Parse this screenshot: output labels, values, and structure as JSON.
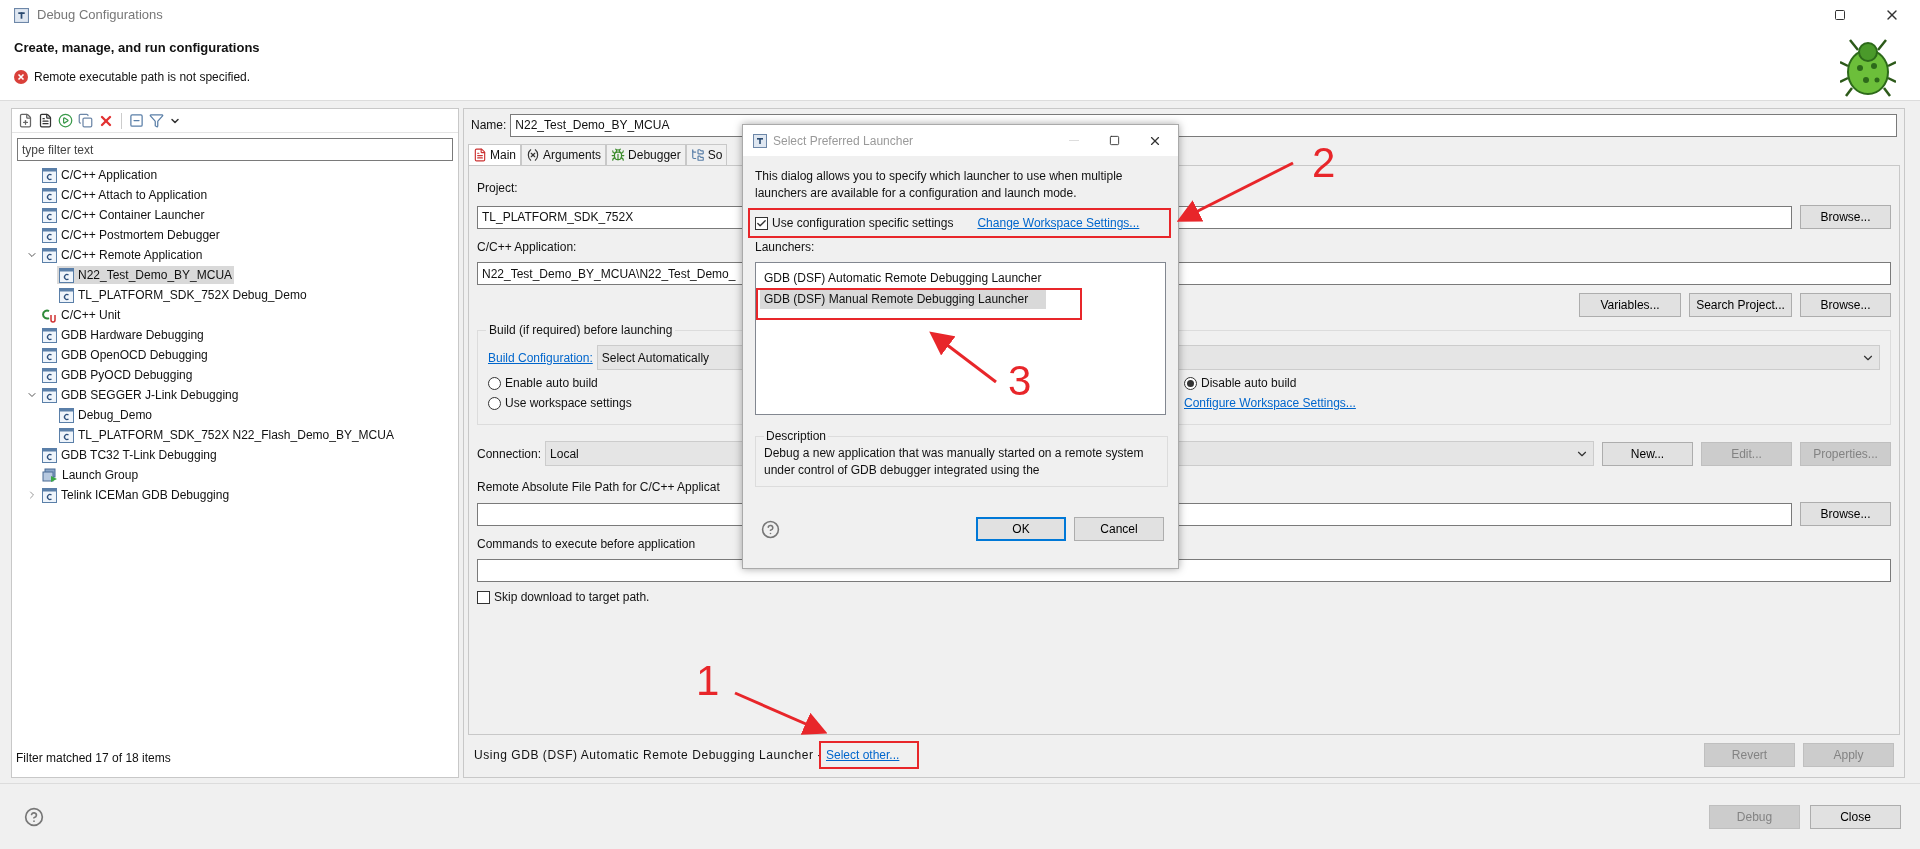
{
  "window": {
    "title": "Debug Configurations"
  },
  "header": {
    "title": "Create, manage, and run configurations",
    "message": "Remote executable path is not specified."
  },
  "sidebar": {
    "filter_placeholder": "type filter text",
    "items": [
      {
        "label": "C/C++ Application",
        "kind": "config",
        "selected": false
      },
      {
        "label": "C/C++ Attach to Application",
        "kind": "config",
        "selected": false
      },
      {
        "label": "C/C++ Container Launcher",
        "kind": "config",
        "selected": false
      },
      {
        "label": "C/C++ Postmortem Debugger",
        "kind": "config",
        "selected": false
      },
      {
        "label": "C/C++ Remote Application",
        "kind": "config",
        "selected": false,
        "expanded": true,
        "children": [
          {
            "label": "N22_Test_Demo_BY_MCUA",
            "kind": "config",
            "selected": true
          },
          {
            "label": "TL_PLATFORM_SDK_752X Debug_Demo",
            "kind": "config",
            "selected": false
          }
        ]
      },
      {
        "label": "C/C++ Unit",
        "kind": "unit",
        "selected": false
      },
      {
        "label": "GDB Hardware Debugging",
        "kind": "config",
        "selected": false
      },
      {
        "label": "GDB OpenOCD Debugging",
        "kind": "config",
        "selected": false
      },
      {
        "label": "GDB PyOCD Debugging",
        "kind": "config",
        "selected": false
      },
      {
        "label": "GDB SEGGER J-Link Debugging",
        "kind": "config",
        "selected": false,
        "expanded": true,
        "children": [
          {
            "label": "Debug_Demo",
            "kind": "config",
            "selected": false
          },
          {
            "label": "TL_PLATFORM_SDK_752X N22_Flash_Demo_BY_MCUA",
            "kind": "config",
            "selected": false
          }
        ]
      },
      {
        "label": "GDB TC32 T-Link Debugging",
        "kind": "config",
        "selected": false
      },
      {
        "label": "Launch Group",
        "kind": "group",
        "selected": false
      },
      {
        "label": "Telink ICEMan GDB Debugging",
        "kind": "config",
        "selected": false,
        "expanded": false
      }
    ],
    "status": "Filter matched 17 of 18 items"
  },
  "name": {
    "label": "Name:",
    "value": "N22_Test_Demo_BY_MCUA"
  },
  "tabs": [
    {
      "label": "Main",
      "kind": "main",
      "selected": true
    },
    {
      "label": "Arguments",
      "kind": "arguments",
      "selected": false
    },
    {
      "label": "Debugger",
      "kind": "debugger",
      "selected": false
    },
    {
      "label": "So",
      "kind": "source",
      "selected": false
    }
  ],
  "main": {
    "project_label": "Project:",
    "project_value": "TL_PLATFORM_SDK_752X",
    "project_button": "Browse...",
    "app_label": "C/C++ Application:",
    "app_value": "N22_Test_Demo_BY_MCUA\\N22_Test_Demo_",
    "app_buttons": [
      "Variables...",
      "Search Project...",
      "Browse..."
    ],
    "build": {
      "legend": "Build (if required) before launching",
      "config_link": "Build Configuration:",
      "config_value": "Select Automatically",
      "options": [
        {
          "label": "Enable auto build",
          "selected": false
        },
        {
          "label": "Disable auto build",
          "selected": true
        },
        {
          "label": "Use workspace settings",
          "selected": false
        }
      ],
      "workspace_link": "Configure Workspace Settings..."
    },
    "connection": {
      "label": "Connection:",
      "value": "Local",
      "buttons": [
        {
          "label": "New...",
          "disabled": false
        },
        {
          "label": "Edit...",
          "disabled": true
        },
        {
          "label": "Properties...",
          "disabled": true
        }
      ]
    },
    "remote_path": {
      "label": "Remote Absolute File Path for C/C++ Applicat",
      "button": "Browse..."
    },
    "commands": {
      "label": "Commands to execute before application"
    },
    "skip_download": {
      "label": "Skip download to target path.",
      "checked": false
    }
  },
  "launcher_line": {
    "text": "Using GDB (DSF) Automatic Remote Debugging Launcher -",
    "link": "Select other..."
  },
  "panel_buttons": [
    {
      "label": "Revert",
      "disabled": true
    },
    {
      "label": "Apply",
      "disabled": true
    }
  ],
  "footer_buttons": [
    {
      "label": "Debug",
      "disabled": true
    },
    {
      "label": "Close",
      "disabled": false
    }
  ],
  "dialog": {
    "title": "Select Preferred Launcher",
    "intro": "This dialog allows you to specify which launcher to use when multiple launchers are available for a configuration and launch mode.",
    "use_specific": {
      "label": "Use configuration specific settings",
      "checked": true
    },
    "workspace_link": "Change Workspace Settings...",
    "launchers_label": "Launchers:",
    "launchers": [
      {
        "label": "GDB (DSF) Automatic Remote Debugging Launcher",
        "selected": false
      },
      {
        "label": "GDB (DSF) Manual Remote Debugging Launcher",
        "selected": true
      }
    ],
    "description_legend": "Description",
    "description": "Debug a new application that was manually started on a remote system under control of GDB debugger integrated using the",
    "buttons": [
      {
        "label": "OK",
        "kind": "default"
      },
      {
        "label": "Cancel",
        "kind": "normal"
      }
    ]
  },
  "annotations": [
    {
      "label": "1"
    },
    {
      "label": "2"
    },
    {
      "label": "3"
    }
  ]
}
